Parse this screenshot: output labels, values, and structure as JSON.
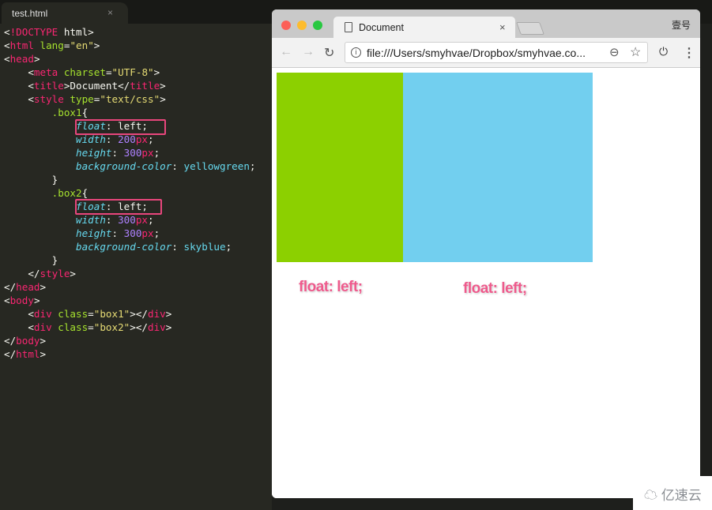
{
  "editor": {
    "tab": {
      "name": "test.html",
      "close": "×"
    },
    "lines": [
      [
        [
          "<",
          "w"
        ],
        [
          "!DOCTYPE",
          "t"
        ],
        [
          " html>",
          "w"
        ]
      ],
      [
        [
          "<",
          "w"
        ],
        [
          "html",
          "t"
        ],
        [
          " lang",
          "a"
        ],
        [
          "=",
          "w"
        ],
        [
          "\"en\"",
          "s"
        ],
        [
          ">",
          "w"
        ]
      ],
      [
        [
          "<",
          "w"
        ],
        [
          "head",
          "t"
        ],
        [
          ">",
          "w"
        ]
      ],
      [
        [
          "    <",
          "w"
        ],
        [
          "meta",
          "t"
        ],
        [
          " charset",
          "a"
        ],
        [
          "=",
          "w"
        ],
        [
          "\"UTF-8\"",
          "s"
        ],
        [
          ">",
          "w"
        ]
      ],
      [
        [
          "    <",
          "w"
        ],
        [
          "title",
          "t"
        ],
        [
          ">Document</",
          "w"
        ],
        [
          "title",
          "t"
        ],
        [
          ">",
          "w"
        ]
      ],
      [
        [
          "    <",
          "w"
        ],
        [
          "style",
          "t"
        ],
        [
          " type",
          "a"
        ],
        [
          "=",
          "w"
        ],
        [
          "\"text/css\"",
          "s"
        ],
        [
          ">",
          "w"
        ]
      ],
      [
        [
          "        .box1",
          "a"
        ],
        [
          "{",
          "w"
        ]
      ],
      [
        [
          "            ",
          "w"
        ],
        [
          "float",
          "p"
        ],
        [
          ": left;",
          "w"
        ]
      ],
      [
        [
          "            ",
          "w"
        ],
        [
          "width",
          "p"
        ],
        [
          ": ",
          "w"
        ],
        [
          "200",
          "n"
        ],
        [
          "px",
          "t"
        ],
        [
          ";",
          "w"
        ]
      ],
      [
        [
          "            ",
          "w"
        ],
        [
          "height",
          "p"
        ],
        [
          ": ",
          "w"
        ],
        [
          "300",
          "n"
        ],
        [
          "px",
          "t"
        ],
        [
          ";",
          "w"
        ]
      ],
      [
        [
          "            ",
          "w"
        ],
        [
          "background-color",
          "p"
        ],
        [
          ": ",
          "w"
        ],
        [
          "yellowgreen",
          "v"
        ],
        [
          ";",
          "w"
        ]
      ],
      [
        [
          "        }",
          "w"
        ]
      ],
      [
        [
          "        .box2",
          "a"
        ],
        [
          "{",
          "w"
        ]
      ],
      [
        [
          "            ",
          "w"
        ],
        [
          "float",
          "p"
        ],
        [
          ": left;",
          "w"
        ]
      ],
      [
        [
          "            ",
          "w"
        ],
        [
          "width",
          "p"
        ],
        [
          ": ",
          "w"
        ],
        [
          "300",
          "n"
        ],
        [
          "px",
          "t"
        ],
        [
          ";",
          "w"
        ]
      ],
      [
        [
          "            ",
          "w"
        ],
        [
          "height",
          "p"
        ],
        [
          ": ",
          "w"
        ],
        [
          "300",
          "n"
        ],
        [
          "px",
          "t"
        ],
        [
          ";",
          "w"
        ]
      ],
      [
        [
          "            ",
          "w"
        ],
        [
          "background-color",
          "p"
        ],
        [
          ": ",
          "w"
        ],
        [
          "skyblue",
          "v"
        ],
        [
          ";",
          "w"
        ]
      ],
      [
        [
          "        }",
          "w"
        ]
      ],
      [
        [
          "    </",
          "w"
        ],
        [
          "style",
          "t"
        ],
        [
          ">",
          "w"
        ]
      ],
      [
        [
          "</",
          "w"
        ],
        [
          "head",
          "t"
        ],
        [
          ">",
          "w"
        ]
      ],
      [
        [
          "<",
          "w"
        ],
        [
          "body",
          "t"
        ],
        [
          ">",
          "w"
        ]
      ],
      [
        [
          "    <",
          "w"
        ],
        [
          "div",
          "t"
        ],
        [
          " class",
          "a"
        ],
        [
          "=",
          "w"
        ],
        [
          "\"box1\"",
          "s"
        ],
        [
          "></",
          "w"
        ],
        [
          "div",
          "t"
        ],
        [
          ">",
          "w"
        ]
      ],
      [
        [
          "    <",
          "w"
        ],
        [
          "div",
          "t"
        ],
        [
          " class",
          "a"
        ],
        [
          "=",
          "w"
        ],
        [
          "\"box2\"",
          "s"
        ],
        [
          "></",
          "w"
        ],
        [
          "div",
          "t"
        ],
        [
          ">",
          "w"
        ]
      ],
      [
        [
          "</",
          "w"
        ],
        [
          "body",
          "t"
        ],
        [
          ">",
          "w"
        ]
      ],
      [
        [
          "</",
          "w"
        ],
        [
          "html",
          "t"
        ],
        [
          ">",
          "w"
        ]
      ]
    ]
  },
  "browser": {
    "tab_title": "Document",
    "tab_close": "×",
    "user": "壹号",
    "url": "file:///Users/smyhvae/Dropbox/smyhvae.co...",
    "icons": [
      "back-icon",
      "forward-icon",
      "reload-icon",
      "info-icon",
      "zoom-out-icon",
      "star-icon",
      "power-icon",
      "menu-icon"
    ],
    "box1_color": "#8cd000",
    "box2_color": "#72cfef"
  },
  "annotations": [
    "float: left;",
    "float: left;"
  ],
  "watermark": "亿速云"
}
